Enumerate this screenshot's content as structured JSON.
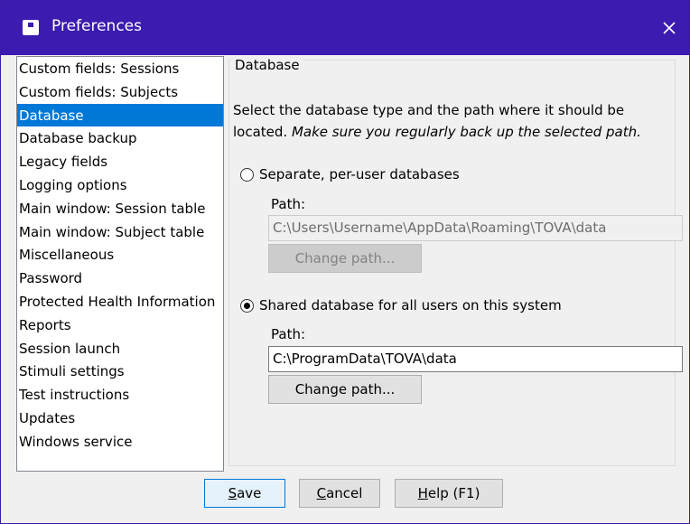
{
  "window": {
    "title": "Preferences"
  },
  "sidebar": {
    "items": [
      {
        "label": "Custom fields: Sessions"
      },
      {
        "label": "Custom fields: Subjects"
      },
      {
        "label": "Database",
        "selected": true
      },
      {
        "label": "Database backup"
      },
      {
        "label": "Legacy fields"
      },
      {
        "label": "Logging options"
      },
      {
        "label": "Main window: Session table"
      },
      {
        "label": "Main window: Subject table"
      },
      {
        "label": "Miscellaneous"
      },
      {
        "label": "Password"
      },
      {
        "label": "Protected Health Information"
      },
      {
        "label": "Reports"
      },
      {
        "label": "Session launch"
      },
      {
        "label": "Stimuli settings"
      },
      {
        "label": "Test instructions"
      },
      {
        "label": "Updates"
      },
      {
        "label": "Windows service"
      }
    ]
  },
  "panel": {
    "title": "Database",
    "description_line1": "Select the database type and the path where it should be",
    "description_line2_prefix": "located. ",
    "description_line2_italic": "Make sure you regularly back up the selected path.",
    "option_separate": {
      "label": "Separate, per-user databases",
      "checked": false,
      "path_label": "Path:",
      "path_value": "C:\\Users\\Username\\AppData\\Roaming\\TOVA\\data",
      "change_label": "Change path...",
      "enabled": false
    },
    "option_shared": {
      "label": "Shared database for all users on this system",
      "checked": true,
      "path_label": "Path:",
      "path_value": "C:\\ProgramData\\TOVA\\data",
      "change_label": "Change path...",
      "enabled": true
    }
  },
  "footer": {
    "save_u": "S",
    "save_rest": "ave",
    "cancel_u": "C",
    "cancel_rest": "ancel",
    "help_u": "H",
    "help_rest": "elp (F1)"
  },
  "colors": {
    "titlebar": "#3c1bb0",
    "selection": "#0078d7",
    "window_bg": "#f0f0f0"
  }
}
